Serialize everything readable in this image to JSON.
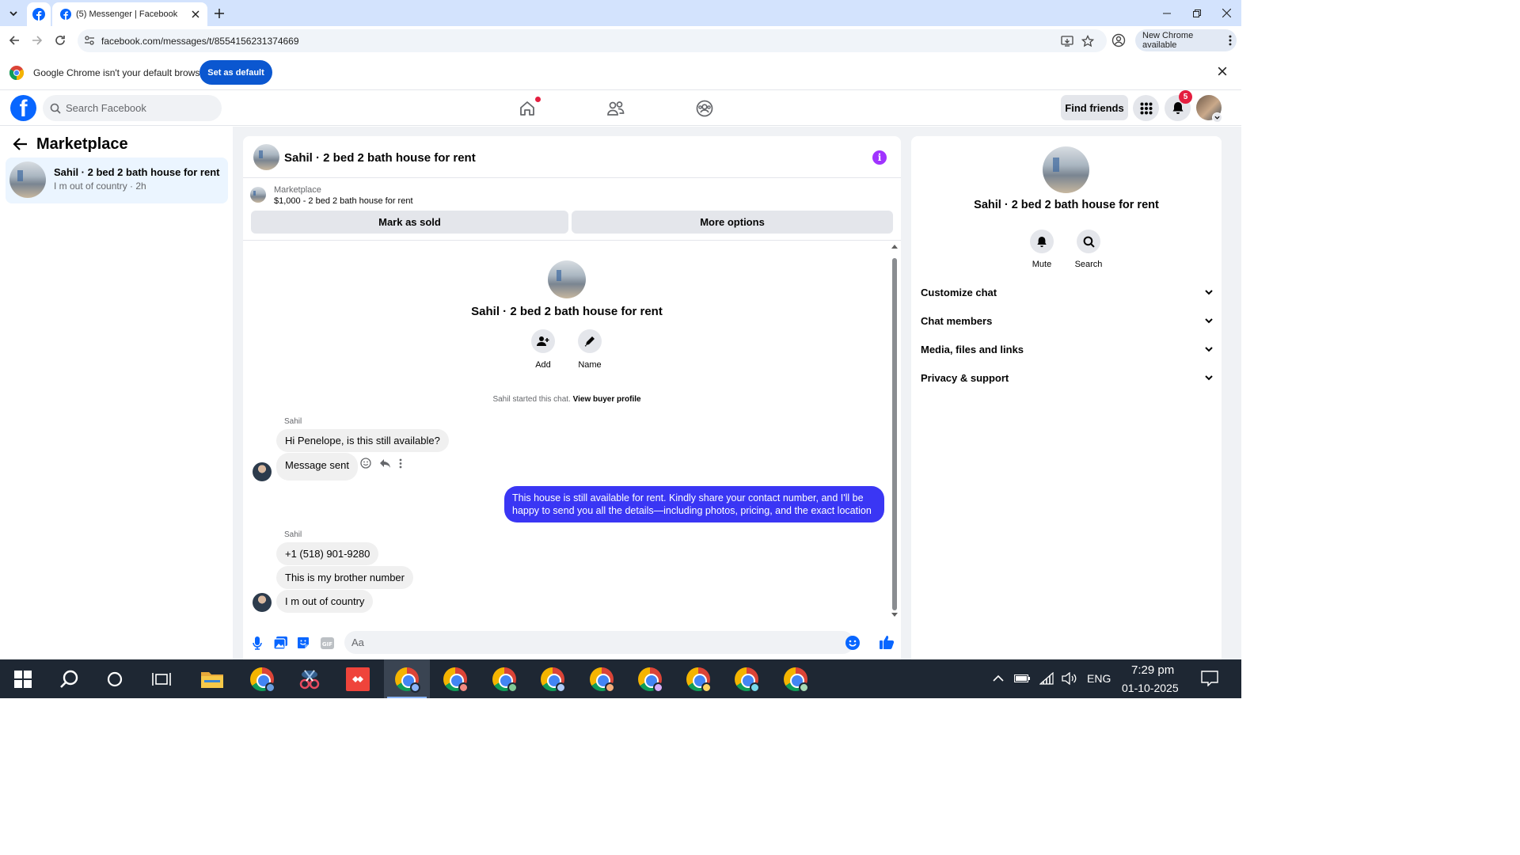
{
  "browser": {
    "tab_title": "(5) Messenger | Facebook",
    "url": "facebook.com/messages/t/8554156231374669",
    "new_chrome": "New Chrome available",
    "infobar_text": "Google Chrome isn't your default browser",
    "set_default": "Set as default"
  },
  "fb": {
    "search_placeholder": "Search Facebook",
    "find_friends": "Find friends",
    "notification_count": "5"
  },
  "left": {
    "title": "Marketplace",
    "conversation": {
      "name": "Sahil · 2 bed 2 bath house for rent",
      "preview": "I m out of country · 2h"
    }
  },
  "chat": {
    "header_title": "Sahil · 2 bed 2 bath house for rent",
    "listing_category": "Marketplace",
    "listing_price": "$1,000 - 2 bed 2 bath house for rent",
    "mark_sold": "Mark as sold",
    "more_options": "More options",
    "hero_title": "Sahil · 2 bed 2 bath house for rent",
    "add_label": "Add",
    "name_label": "Name",
    "started_text": "Sahil started this chat.",
    "view_buyer": "View buyer profile",
    "sender1": "Sahil",
    "msg1": "Hi Penelope, is this still available?",
    "msg2": "Message sent",
    "msg_out": "This house is still available for rent. Kindly share your contact number, and I'll be happy to send you all the details—including photos, pricing, and the exact location",
    "sender2": "Sahil",
    "msg3": "+1 (518) 901-9280",
    "msg4": "This is my brother number",
    "msg5": "I m out of country",
    "composer_placeholder": "Aa"
  },
  "right": {
    "title": "Sahil · 2 bed 2 bath house for rent",
    "mute": "Mute",
    "search": "Search",
    "sections": [
      "Customize chat",
      "Chat members",
      "Media, files and links",
      "Privacy & support"
    ]
  },
  "taskbar": {
    "lang": "ENG",
    "time": "7:29 pm",
    "date": "01-10-2025"
  },
  "colors": {
    "fb_blue": "#0866ff",
    "outgoing_bubble": "#3a36f4",
    "info_purple": "#a033ff"
  }
}
